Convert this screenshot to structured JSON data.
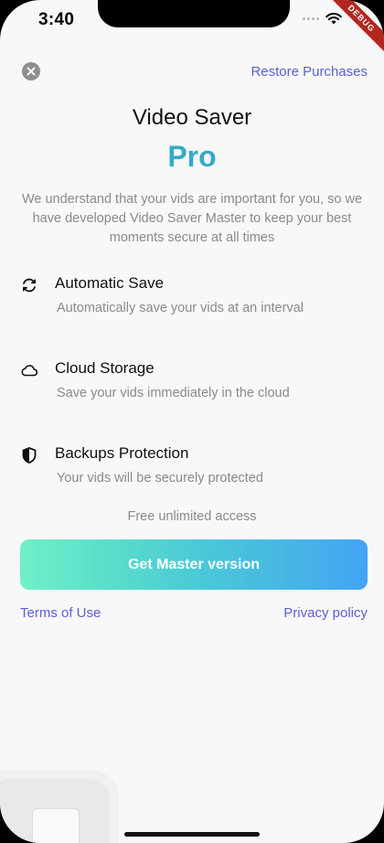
{
  "status_bar": {
    "time": "3:40",
    "debug_label": "DEBUG"
  },
  "header": {
    "close_icon": "close-icon",
    "restore_label": "Restore Purchases"
  },
  "hero": {
    "title": "Video Saver",
    "subtitle": "Pro",
    "description": "We understand that your vids are important for you, so we have developed Video Saver Master to keep your best moments secure at all times"
  },
  "features": [
    {
      "icon": "sync-icon",
      "title": "Automatic Save",
      "description": "Automatically save your vids at an interval"
    },
    {
      "icon": "cloud-icon",
      "title": "Cloud Storage",
      "description": "Save your vids immediately in the cloud"
    },
    {
      "icon": "shield-icon",
      "title": "Backups Protection",
      "description": "Your vids will be securely protected"
    }
  ],
  "offer": {
    "note": "Free unlimited access",
    "cta_label": "Get Master version"
  },
  "footer": {
    "terms_label": "Terms of Use",
    "privacy_label": "Privacy policy"
  },
  "colors": {
    "accent": "#35a9c9",
    "link": "#5b5fd6",
    "gradient_start": "#6ff0c8",
    "gradient_end": "#43a3f5"
  }
}
